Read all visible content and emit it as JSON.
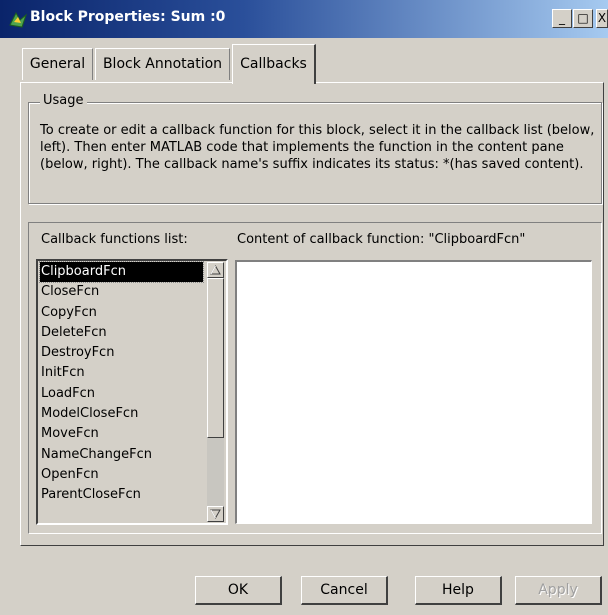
{
  "window": {
    "title": "Block Properties: Sum :0",
    "controls": {
      "minimize": "_",
      "maximize": "□",
      "close": "X"
    }
  },
  "tabs": [
    {
      "label": "General",
      "active": false
    },
    {
      "label": "Block Annotation",
      "active": false
    },
    {
      "label": "Callbacks",
      "active": true
    }
  ],
  "usage": {
    "legend": "Usage",
    "text": "To create or edit a callback function for this block, select it in the callback list (below, left). Then enter MATLAB code that implements the function in the content pane (below, right). The callback name's suffix indicates its status: *(has saved content)."
  },
  "callbacks": {
    "list_label": "Callback functions list:",
    "content_label": "Content of callback function:  \"ClipboardFcn\"",
    "selected": "ClipboardFcn",
    "items": [
      "ClipboardFcn",
      "CloseFcn",
      "CopyFcn",
      "DeleteFcn",
      "DestroyFcn",
      "InitFcn",
      "LoadFcn",
      "ModelCloseFcn",
      "MoveFcn",
      "NameChangeFcn",
      "OpenFcn",
      "ParentCloseFcn"
    ],
    "content": ""
  },
  "buttons": {
    "ok": "OK",
    "cancel": "Cancel",
    "help": "Help",
    "apply": "Apply"
  }
}
